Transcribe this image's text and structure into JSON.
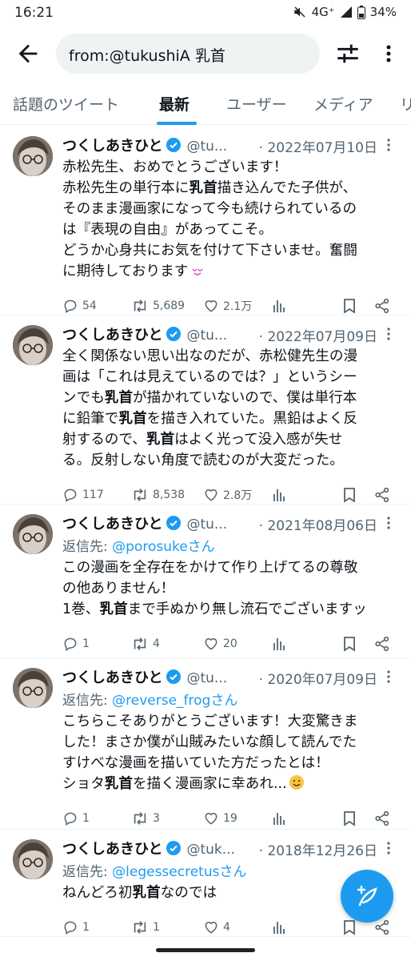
{
  "status_bar": {
    "time": "16:21",
    "network": "4G⁺",
    "battery": "34%"
  },
  "search": {
    "query": "from:@tukushiA 乳首"
  },
  "tabs": [
    {
      "label": "話題のツイート"
    },
    {
      "label": "最新"
    },
    {
      "label": "ユーザー"
    },
    {
      "label": "メディア"
    },
    {
      "label": "リ"
    }
  ],
  "colors": {
    "accent": "#1d9bf0",
    "text": "#0f1419",
    "secondary": "#536471",
    "heart_emoji": "#e05fd0",
    "smile_emoji": "#f5c542"
  },
  "tweets": [
    {
      "name": "つくしあきひと",
      "handle": "@tu...",
      "date": "· 2022年07月10日",
      "reply_label": "",
      "reply_to": "",
      "lines": [
        [
          "赤松先生、おめでとうございます！"
        ],
        [
          "赤松先生の単行本に",
          "乳首",
          "描き込んでた子供が、"
        ],
        [
          "そのまま漫画家になって今も続けられているの"
        ],
        [
          "は『表現の自由』があってこそ。"
        ],
        [
          "どうか心身共にお気を付けて下さいませ。奮闘"
        ],
        [
          "に期待しております"
        ]
      ],
      "replies": "54",
      "retweets": "5,689",
      "likes": "2.1万"
    },
    {
      "name": "つくしあきひと",
      "handle": "@tu...",
      "date": "· 2022年07月09日",
      "reply_label": "",
      "reply_to": "",
      "lines": [
        [
          "全く関係ない思い出なのだが、赤松健先生の漫"
        ],
        [
          "画は「これは見えているのでは？」というシー"
        ],
        [
          "ンでも",
          "乳首",
          "が描かれていないので、僕は単行本"
        ],
        [
          "に鉛筆で",
          "乳首",
          "を描き入れていた。黒鉛はよく反"
        ],
        [
          "射するので、",
          "乳首",
          "はよく光って没入感が失せ"
        ],
        [
          "る。反射しない角度で読むのが大変だった。"
        ]
      ],
      "replies": "117",
      "retweets": "8,538",
      "likes": "2.8万"
    },
    {
      "name": "つくしあきひと",
      "handle": "@tu...",
      "date": "· 2021年08月06日",
      "reply_label": "返信先: ",
      "reply_to": "@porosukeさん",
      "lines": [
        [
          "この漫画を全存在をかけて作り上げてるの尊敬"
        ],
        [
          "の他ありません！"
        ],
        [
          "1巻、",
          "乳首",
          "まで手ぬかり無し流石でございますッ"
        ]
      ],
      "replies": "1",
      "retweets": "4",
      "likes": "20"
    },
    {
      "name": "つくしあきひと",
      "handle": "@tu...",
      "date": "· 2020年07月09日",
      "reply_label": "返信先: ",
      "reply_to": "@reverse_frogさん",
      "lines": [
        [
          "こちらこそありがとうございます！大変驚きま"
        ],
        [
          "した！まさか僕が山賊みたいな顔して読んでた"
        ],
        [
          "すけべな漫画を描いていた方だったとは！"
        ],
        [
          "ショタ",
          "乳首",
          "を描く漫画家に幸あれ..."
        ]
      ],
      "replies": "1",
      "retweets": "3",
      "likes": "19"
    },
    {
      "name": "つくしあきひと",
      "handle": "@tuk...",
      "date": "· 2018年12月26日",
      "reply_label": "返信先: ",
      "reply_to": "@legessecretusさん",
      "lines": [
        [
          "ねんどろ初",
          "乳首",
          "なのでは"
        ]
      ],
      "replies": "1",
      "retweets": "1",
      "likes": "4"
    }
  ]
}
